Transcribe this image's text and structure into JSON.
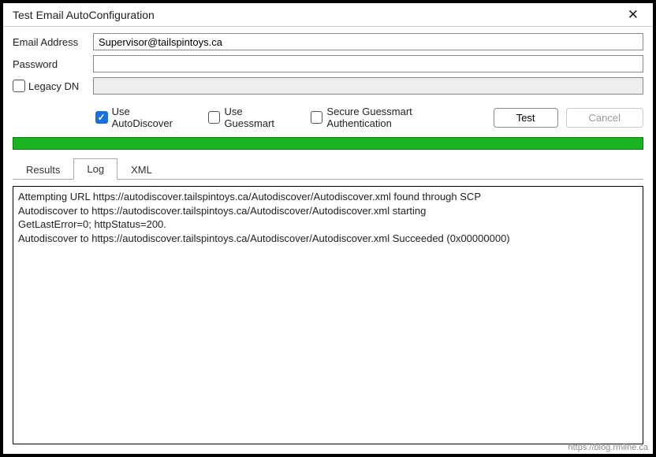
{
  "window": {
    "title": "Test Email AutoConfiguration"
  },
  "fields": {
    "email_label": "Email Address",
    "email_value": "Supervisor@tailspintoys.ca",
    "password_label": "Password",
    "password_value": "",
    "legacy_dn_label": "Legacy DN",
    "legacy_dn_value": ""
  },
  "options": {
    "use_autodiscover": "Use AutoDiscover",
    "use_guessmart": "Use Guessmart",
    "secure_guessmart": "Secure Guessmart Authentication"
  },
  "buttons": {
    "test": "Test",
    "cancel": "Cancel"
  },
  "tabs": {
    "results": "Results",
    "log": "Log",
    "xml": "XML"
  },
  "log_lines": [
    "Attempting URL https://autodiscover.tailspintoys.ca/Autodiscover/Autodiscover.xml found through SCP",
    "Autodiscover to https://autodiscover.tailspintoys.ca/Autodiscover/Autodiscover.xml starting",
    "GetLastError=0; httpStatus=200.",
    "Autodiscover to https://autodiscover.tailspintoys.ca/Autodiscover/Autodiscover.xml Succeeded (0x00000000)"
  ],
  "watermark": "https://blog.rmilne.ca"
}
